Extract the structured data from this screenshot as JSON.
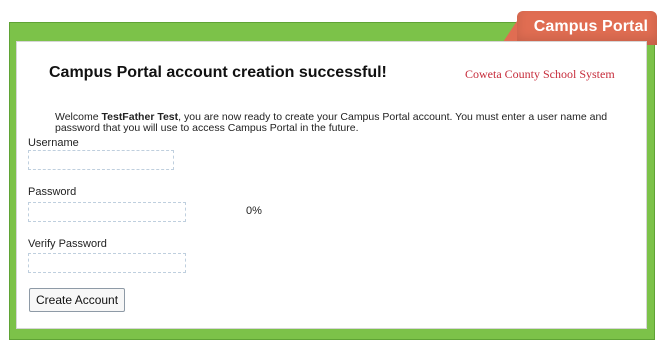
{
  "brand": {
    "title": "Campus Portal"
  },
  "header": {
    "title": "Campus Portal account creation successful!",
    "district": "Coweta County School System"
  },
  "message": {
    "prefix": "Welcome ",
    "name": "TestFather Test",
    "suffix": ", you are now ready to create your Campus Portal account. You must enter a user name and password that you will use to access Campus Portal in the future."
  },
  "form": {
    "username": {
      "label": "Username",
      "value": "",
      "placeholder": ""
    },
    "password": {
      "label": "Password",
      "value": "",
      "placeholder": "",
      "strength": "0%"
    },
    "verify_password": {
      "label": "Verify Password",
      "value": "",
      "placeholder": ""
    },
    "submit_label": "Create Account"
  },
  "colors": {
    "panel_green": "#7cc249",
    "brand_orange": "#e06d52",
    "district_red": "#c62b3a"
  }
}
